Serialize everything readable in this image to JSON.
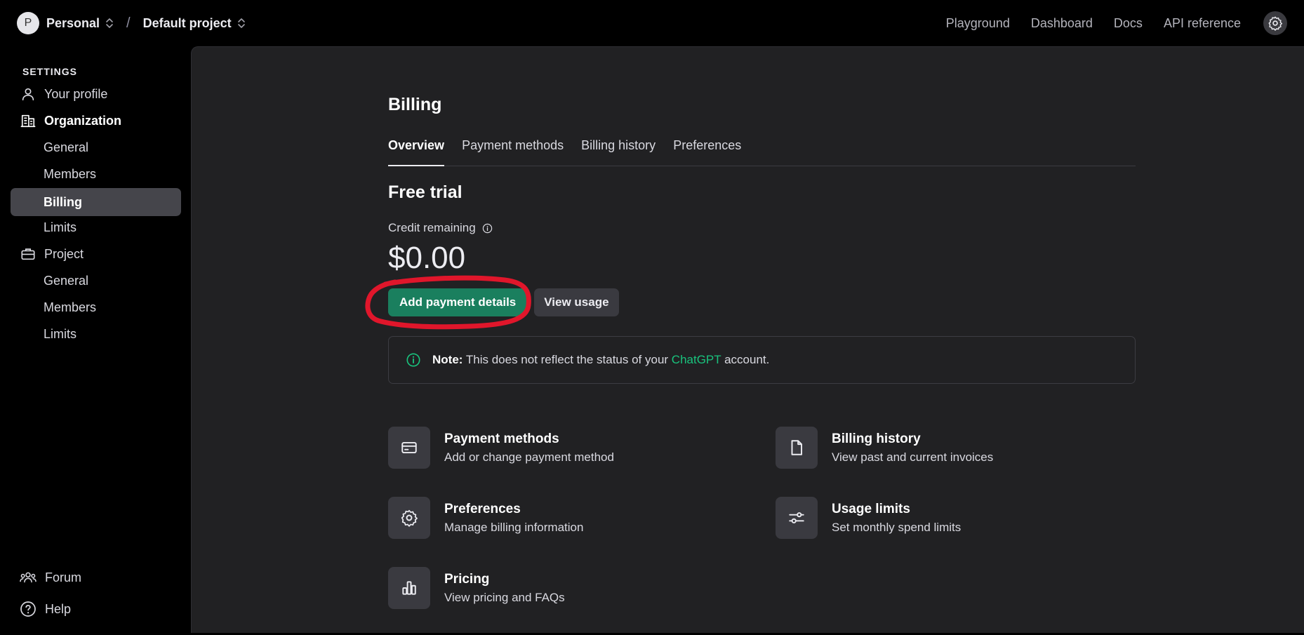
{
  "topbar": {
    "avatar_letter": "P",
    "org_name": "Personal",
    "separator": "/",
    "project_name": "Default project",
    "nav": [
      "Playground",
      "Dashboard",
      "Docs",
      "API reference"
    ]
  },
  "sidebar": {
    "heading": "SETTINGS",
    "items": [
      {
        "label": "Your profile",
        "type": "group-plain",
        "icon": "user-icon"
      },
      {
        "label": "Organization",
        "type": "group",
        "icon": "building-icon"
      },
      {
        "label": "General",
        "type": "sub"
      },
      {
        "label": "Members",
        "type": "sub"
      },
      {
        "label": "Billing",
        "type": "sub",
        "active": true
      },
      {
        "label": "Limits",
        "type": "sub"
      },
      {
        "label": "Project",
        "type": "group-plain",
        "icon": "briefcase-icon"
      },
      {
        "label": "General",
        "type": "sub"
      },
      {
        "label": "Members",
        "type": "sub"
      },
      {
        "label": "Limits",
        "type": "sub"
      }
    ],
    "bottom": [
      {
        "label": "Forum",
        "icon": "people-icon"
      },
      {
        "label": "Help",
        "icon": "help-icon"
      }
    ]
  },
  "main": {
    "title": "Billing",
    "tabs": [
      "Overview",
      "Payment methods",
      "Billing history",
      "Preferences"
    ],
    "active_tab": "Overview",
    "plan": "Free trial",
    "credit_label": "Credit remaining",
    "credit_amount": "$0.00",
    "primary_button": "Add payment details",
    "secondary_button": "View usage",
    "note": {
      "bold": "Note:",
      "before": " This does not reflect the status of your ",
      "link": "ChatGPT",
      "after": " account."
    },
    "cards": [
      {
        "title": "Payment methods",
        "desc": "Add or change payment method",
        "icon": "credit-card-icon"
      },
      {
        "title": "Billing history",
        "desc": "View past and current invoices",
        "icon": "document-icon"
      },
      {
        "title": "Preferences",
        "desc": "Manage billing information",
        "icon": "gear-icon"
      },
      {
        "title": "Usage limits",
        "desc": "Set monthly spend limits",
        "icon": "sliders-icon"
      },
      {
        "title": "Pricing",
        "desc": "View pricing and FAQs",
        "icon": "bar-chart-icon"
      }
    ]
  },
  "colors": {
    "accent": "#1a7f5e",
    "link": "#19c37d",
    "annotation": "#e0162b"
  }
}
